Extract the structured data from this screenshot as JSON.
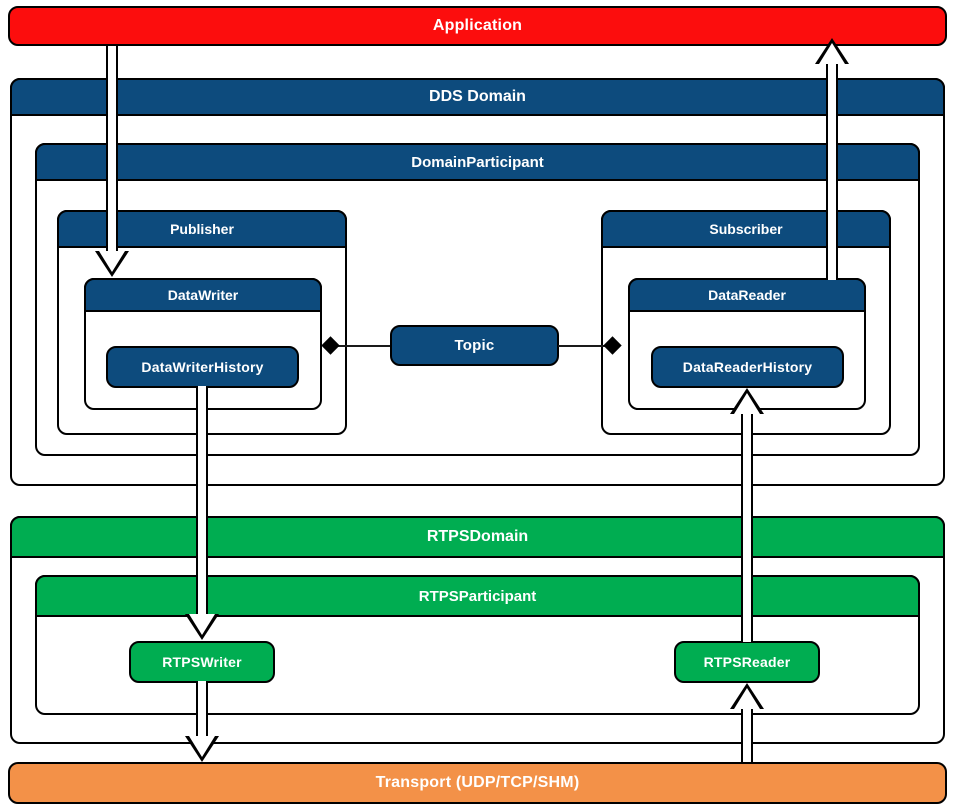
{
  "diagram": {
    "title": "Fast DDS layered architecture",
    "layers": {
      "application": {
        "label": "Application",
        "color": "#fc0d0d"
      },
      "dds_domain": {
        "label": "DDS Domain",
        "color": "#0d4b7d"
      },
      "domain_participant": {
        "label": "DomainParticipant",
        "color": "#0d4b7d"
      },
      "publisher": {
        "label": "Publisher",
        "color": "#0d4b7d"
      },
      "subscriber": {
        "label": "Subscriber",
        "color": "#0d4b7d"
      },
      "data_writer": {
        "label": "DataWriter",
        "color": "#0d4b7d"
      },
      "data_reader": {
        "label": "DataReader",
        "color": "#0d4b7d"
      },
      "data_writer_history": {
        "label": "DataWriterHistory",
        "color": "#0d4b7d"
      },
      "data_reader_history": {
        "label": "DataReaderHistory",
        "color": "#0d4b7d"
      },
      "topic": {
        "label": "Topic",
        "color": "#0d4b7d"
      },
      "rtps_domain": {
        "label": "RTPSDomain",
        "color": "#00ad51"
      },
      "rtps_participant": {
        "label": "RTPSParticipant",
        "color": "#00ad51"
      },
      "rtps_writer": {
        "label": "RTPSWriter",
        "color": "#00ad51"
      },
      "rtps_reader": {
        "label": "RTPSReader",
        "color": "#00ad51"
      },
      "transport": {
        "label": "Transport (UDP/TCP/SHM)",
        "color": "#f39148"
      }
    },
    "connections": {
      "app_to_datawriter": "write-flow-arrow",
      "datareader_to_app": "read-flow-arrow",
      "writerhistory_to_rtpswriter": "write-flow-arrow",
      "rtpswriter_to_transport": "write-flow-arrow",
      "transport_to_rtpsreader": "read-flow-arrow",
      "rtpsreader_to_readerhistory": "read-flow-arrow",
      "datawriter_topic": "aggregation-association",
      "topic_datareader": "aggregation-association"
    }
  }
}
